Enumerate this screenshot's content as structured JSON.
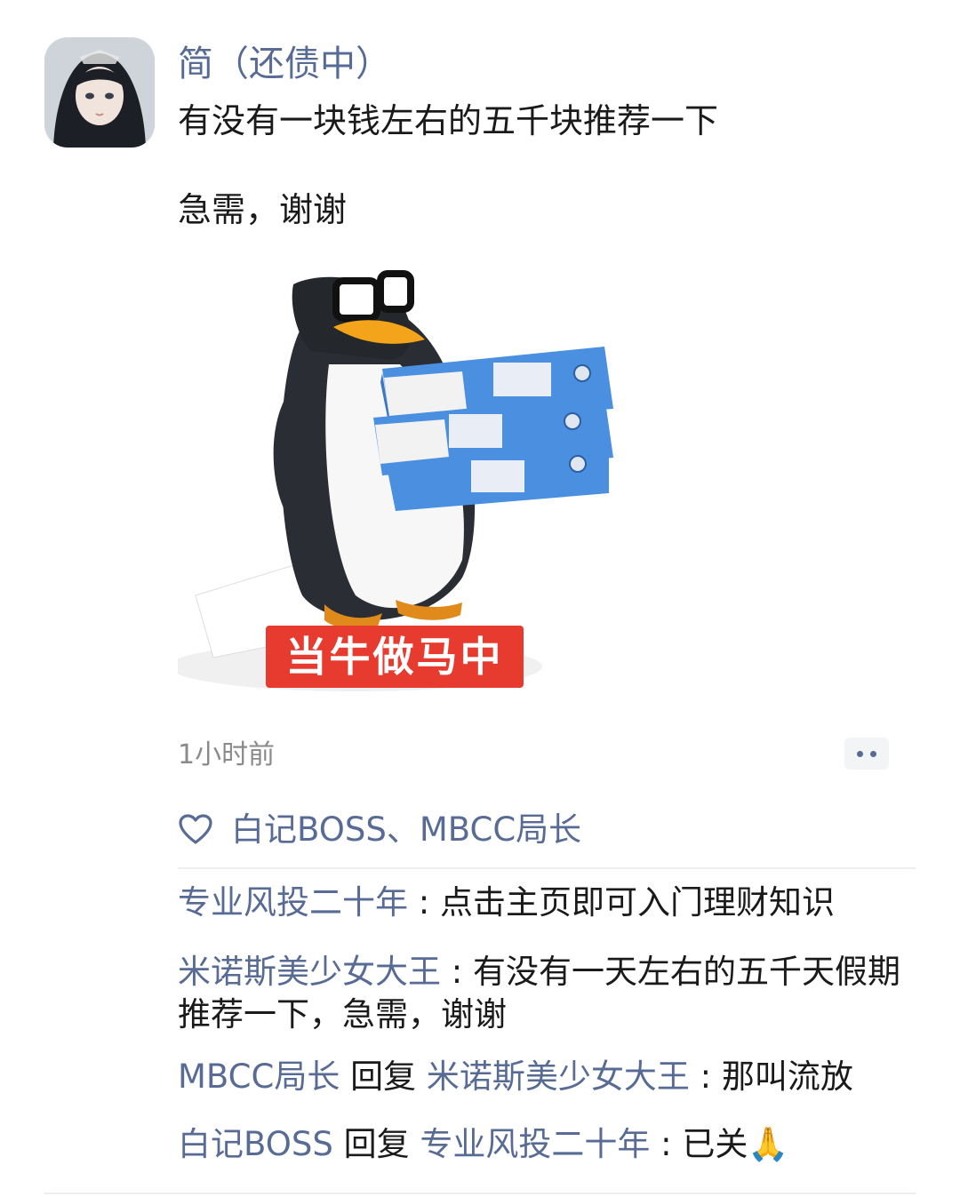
{
  "post": {
    "author": "简（还债中）",
    "text_line_1": "有没有一块钱左右的五千块推荐一下",
    "text_line_2": "急需，谢谢",
    "sticker_caption": "当牛做马中",
    "timestamp": "1小时前"
  },
  "icons": {
    "more": "more-dots-icon",
    "like": "heart-icon",
    "emoji": "praying-hands-emoji"
  },
  "likes": {
    "names": "白记BOSS、MBCC局长"
  },
  "comments": [
    {
      "user": "专业风投二十年",
      "separator": " : ",
      "text": "点击主页即可入门理财知识"
    },
    {
      "user": "米诺斯美少女大王",
      "separator": " : ",
      "text": "有没有一天左右的五千天假期推荐一下，急需，谢谢"
    },
    {
      "user": "MBCC局长",
      "reply_word": " 回复 ",
      "reply_to": "米诺斯美少女大王",
      "separator": " : ",
      "text": "那叫流放"
    },
    {
      "user": "白记BOSS",
      "reply_word": " 回复 ",
      "reply_to": "专业风投二十年",
      "separator": " : ",
      "text": "已关🙏"
    }
  ],
  "colors": {
    "link_blue": "#576b95",
    "caption_red": "#e63b2e",
    "folder_blue": "#4a8fe0"
  }
}
